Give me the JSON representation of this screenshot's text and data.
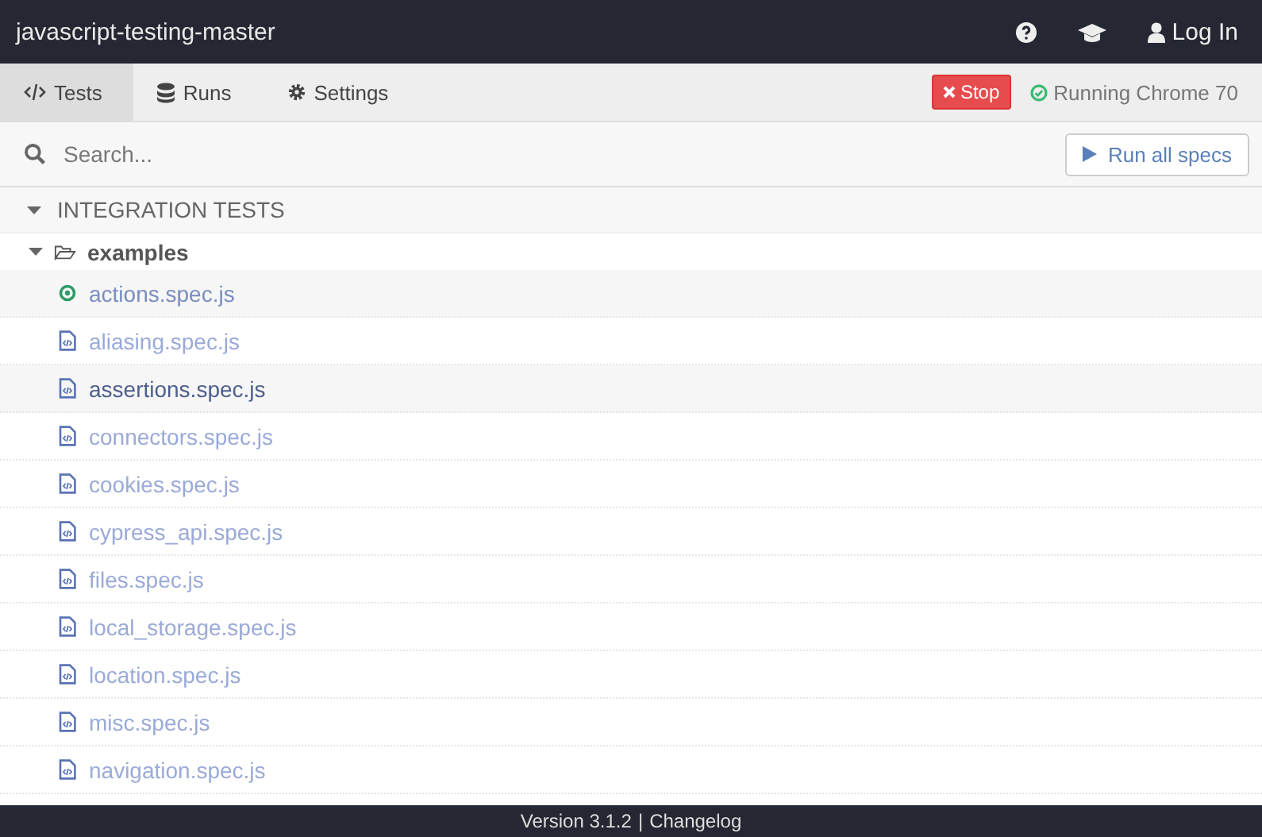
{
  "window": {
    "title": "javascript-testing-master"
  },
  "header_actions": [
    {
      "kind": "help"
    },
    {
      "kind": "learn"
    },
    {
      "kind": "login",
      "label": "Log In"
    }
  ],
  "tabs": [
    {
      "label": "Tests",
      "kind": "code",
      "selected": true
    },
    {
      "label": "Runs",
      "kind": "database",
      "selected": false
    },
    {
      "label": "Settings",
      "kind": "gear",
      "selected": false
    }
  ],
  "stop_button": {
    "label": "Stop"
  },
  "browser_status": {
    "label": "Running Chrome 70"
  },
  "search": {
    "placeholder": "Search..."
  },
  "run_all_button": {
    "label": "Run all specs"
  },
  "tree": {
    "label": "INTEGRATION TESTS",
    "expanded": true,
    "children": [
      {
        "label": "examples",
        "expanded": true,
        "children": [
          {
            "label": "actions.spec.js",
            "kind": "running",
            "selected": false
          },
          {
            "label": "aliasing.spec.js",
            "kind": "spec",
            "selected": false
          },
          {
            "label": "assertions.spec.js",
            "kind": "spec",
            "selected": true
          },
          {
            "label": "connectors.spec.js",
            "kind": "spec",
            "selected": false
          },
          {
            "label": "cookies.spec.js",
            "kind": "spec",
            "selected": false
          },
          {
            "label": "cypress_api.spec.js",
            "kind": "spec",
            "selected": false
          },
          {
            "label": "files.spec.js",
            "kind": "spec",
            "selected": false
          },
          {
            "label": "local_storage.spec.js",
            "kind": "spec",
            "selected": false
          },
          {
            "label": "location.spec.js",
            "kind": "spec",
            "selected": false
          },
          {
            "label": "misc.spec.js",
            "kind": "spec",
            "selected": false
          },
          {
            "label": "navigation.spec.js",
            "kind": "spec",
            "selected": false
          }
        ]
      }
    ]
  },
  "footer": {
    "version": "Version 3.1.2",
    "separator": "|",
    "link": "Changelog"
  }
}
